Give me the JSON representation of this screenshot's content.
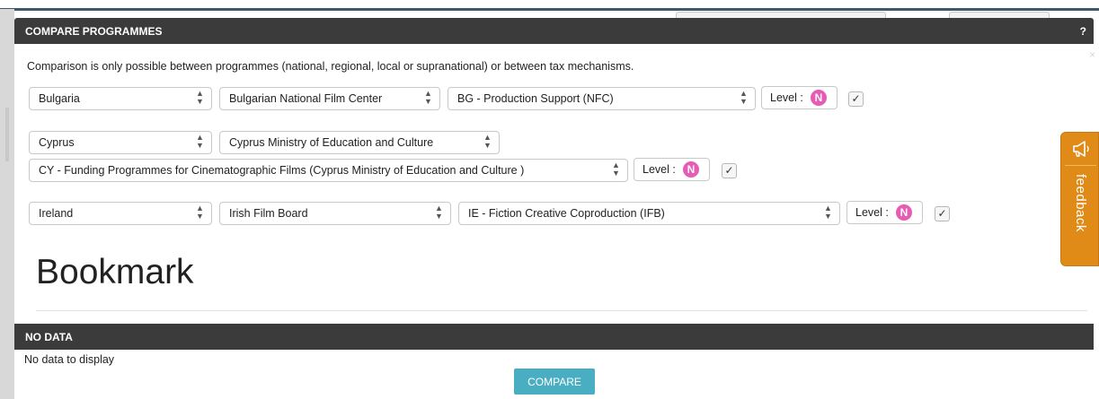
{
  "modal": {
    "title": "COMPARE PROGRAMMES",
    "help": "?",
    "close": "×",
    "intro": "Comparison is only possible between programmes (national, regional, local or supranational) or between tax mechanisms."
  },
  "rows": [
    {
      "country": "Bulgaria",
      "institution": "Bulgarian National Film Center",
      "programme": "BG - Production Support (NFC)",
      "level_label": "Level :",
      "level_value": "N",
      "checked": "✓"
    },
    {
      "country": "Cyprus",
      "institution": "Cyprus Ministry of Education and Culture",
      "programme": "CY - Funding Programmes for Cinematographic Films (Cyprus Ministry of Education and Culture )",
      "level_label": "Level :",
      "level_value": "N",
      "checked": "✓"
    },
    {
      "country": "Ireland",
      "institution": "Irish Film Board",
      "programme": "IE - Fiction Creative Coproduction (IFB)",
      "level_label": "Level :",
      "level_value": "N",
      "checked": "✓"
    }
  ],
  "bookmark": {
    "heading": "Bookmark"
  },
  "results": {
    "header": "NO DATA",
    "empty_text": "No data to display"
  },
  "compare_button": "COMPARE",
  "feedback": {
    "label": "feedback",
    "icon": "megaphone-icon"
  },
  "colors": {
    "header_bg": "#3b3b3b",
    "accent": "#4aaec3",
    "feedback": "#e08a17",
    "level_badge": "#e75bb4"
  }
}
